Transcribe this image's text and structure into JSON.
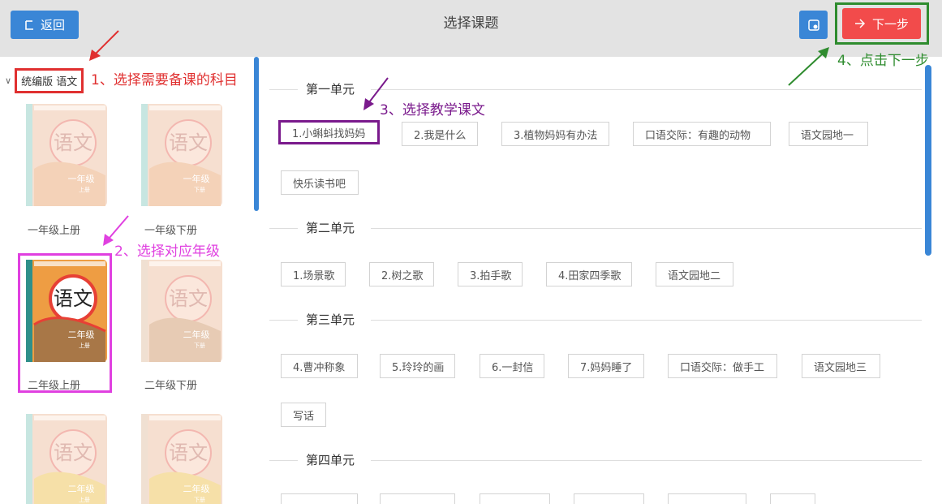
{
  "header": {
    "back_label": "返回",
    "title": "选择课题",
    "next_label": "下一步"
  },
  "subject": {
    "label": "统编版 语文"
  },
  "annotations": {
    "step1": "1、选择需要备课的科目",
    "step2": "2、选择对应年级",
    "step3": "3、选择教学课文",
    "step4": "4、点击下一步"
  },
  "books": [
    {
      "cover_title": "语文",
      "grade": "一年级",
      "term": "上册",
      "label": "一年级上册"
    },
    {
      "cover_title": "语文",
      "grade": "一年级",
      "term": "下册",
      "label": "一年级下册"
    },
    {
      "cover_title": "语文",
      "grade": "二年级",
      "term": "上册",
      "label": "二年级上册"
    },
    {
      "cover_title": "语文",
      "grade": "二年级",
      "term": "下册",
      "label": "二年级下册"
    },
    {
      "cover_title": "语文",
      "grade": "二年级",
      "term": "上册",
      "label": ""
    },
    {
      "cover_title": "语文",
      "grade": "二年级",
      "term": "下册",
      "label": ""
    }
  ],
  "units": [
    {
      "title": "第一单元",
      "lessons": [
        "1.小蝌蚪找妈妈",
        "2.我是什么",
        "3.植物妈妈有办法",
        "口语交际：有趣的动物",
        "语文园地一",
        "快乐读书吧"
      ]
    },
    {
      "title": "第二单元",
      "lessons": [
        "1.场景歌",
        "2.树之歌",
        "3.拍手歌",
        "4.田家四季歌",
        "语文园地二"
      ]
    },
    {
      "title": "第三单元",
      "lessons": [
        "4.曹冲称象",
        "5.玲玲的画",
        "6.一封信",
        "7.妈妈睡了",
        "口语交际：做手工",
        "语文园地三",
        "写话"
      ]
    },
    {
      "title": "第四单元",
      "lessons": []
    }
  ],
  "colors": {
    "primary": "#3a86d6",
    "next_button": "#f24b4b",
    "annotation_red": "#e03030",
    "annotation_pink": "#e040e0",
    "annotation_purple": "#7a1a8c",
    "annotation_green": "#2f8c2f"
  }
}
